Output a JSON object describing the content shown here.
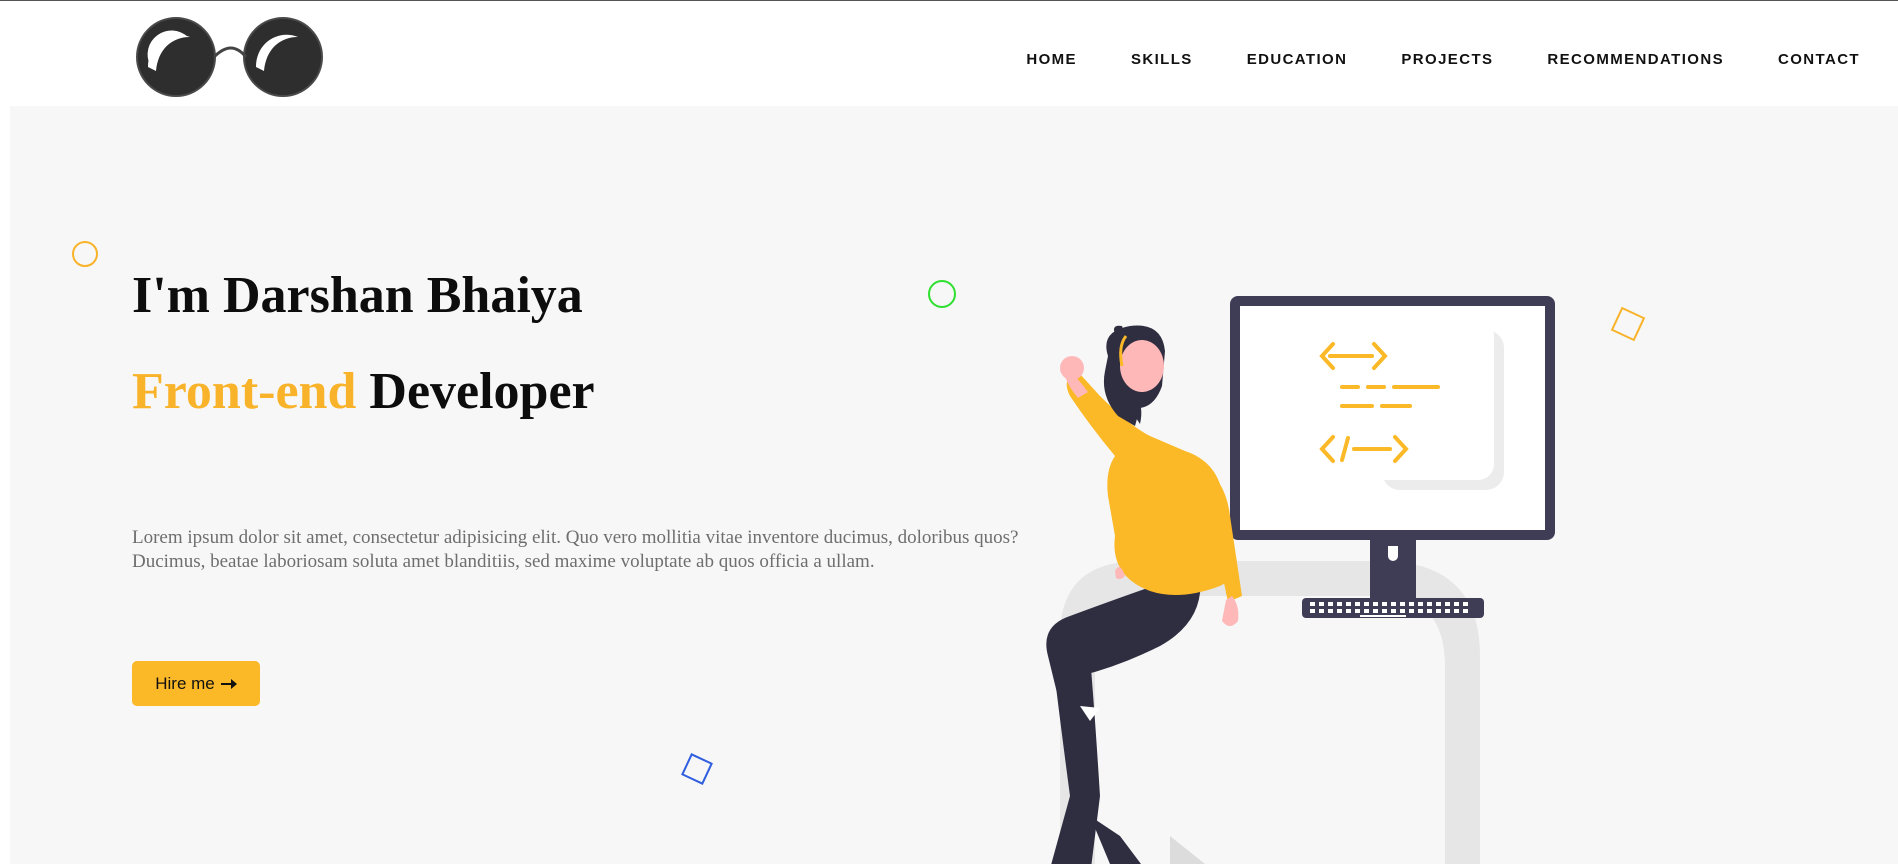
{
  "header": {
    "logo_name": "glasses-logo",
    "nav": [
      {
        "label": "HOME"
      },
      {
        "label": "SKILLS"
      },
      {
        "label": "EDUCATION"
      },
      {
        "label": "PROJECTS"
      },
      {
        "label": "RECOMMENDATIONS"
      },
      {
        "label": "CONTACT"
      }
    ]
  },
  "hero": {
    "greeting": "I'm Darshan Bhaiya",
    "role_accent": "Front-end",
    "role_rest": " Developer",
    "description": "Lorem ipsum dolor sit amet, consectetur adipisicing elit. Quo vero mollitia vitae inventore ducimus, doloribus quos? Ducimus, beatae laboriosam soluta amet blanditiis, sed maxime voluptate ab quos officia a ullam.",
    "cta_label": "Hire me",
    "cta_icon": "arrow-right-icon"
  },
  "colors": {
    "accent": "#fbb827",
    "background": "#f7f7f7",
    "text": "#0d0d0d",
    "muted": "#6e6e6e",
    "deco_green": "#2fe02f",
    "deco_blue": "#2f5fe0"
  }
}
